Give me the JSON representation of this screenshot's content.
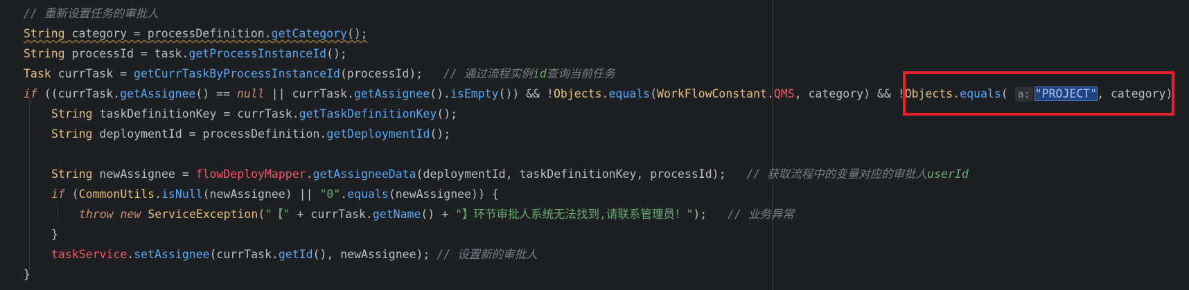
{
  "editor": {
    "lines": [
      {
        "id": "l1",
        "indent": 0,
        "tokens": [
          {
            "t": "// 重新设置任务的审批人",
            "c": "comment"
          }
        ]
      },
      {
        "id": "l2",
        "indent": 0,
        "tokens": [
          {
            "t": "String",
            "c": "ctype ul"
          },
          {
            "t": " category = ",
            "c": "plain ul"
          },
          {
            "t": "processDefinition",
            "c": "plain ul"
          },
          {
            "t": ".",
            "c": "plain ul"
          },
          {
            "t": "getCategory",
            "c": "method ul"
          },
          {
            "t": "();",
            "c": "plain ul"
          }
        ]
      },
      {
        "id": "l3",
        "indent": 0,
        "tokens": [
          {
            "t": "String",
            "c": "ctype"
          },
          {
            "t": " processId = task.",
            "c": "plain"
          },
          {
            "t": "getProcessInstanceId",
            "c": "method"
          },
          {
            "t": "();",
            "c": "plain"
          }
        ]
      },
      {
        "id": "l4",
        "indent": 0,
        "tokens": [
          {
            "t": "Task",
            "c": "ctype"
          },
          {
            "t": " currTask = ",
            "c": "plain"
          },
          {
            "t": "getCurrTaskByProcessInstanceId",
            "c": "method"
          },
          {
            "t": "(processId);   ",
            "c": "plain"
          },
          {
            "t": "// 通过流程实例",
            "c": "comment"
          },
          {
            "t": "id",
            "c": "comment-hl"
          },
          {
            "t": "查询当前任务",
            "c": "comment"
          }
        ]
      },
      {
        "id": "l5",
        "indent": 0,
        "tokens": [
          {
            "t": "if",
            "c": "kwi"
          },
          {
            "t": " ((currTask.",
            "c": "plain"
          },
          {
            "t": "getAssignee",
            "c": "method"
          },
          {
            "t": "() == ",
            "c": "plain"
          },
          {
            "t": "null",
            "c": "kwi"
          },
          {
            "t": " || currTask.",
            "c": "plain"
          },
          {
            "t": "getAssignee",
            "c": "method"
          },
          {
            "t": "().",
            "c": "plain"
          },
          {
            "t": "isEmpty",
            "c": "method"
          },
          {
            "t": "()) && !",
            "c": "plain"
          },
          {
            "t": "Objects",
            "c": "ctype"
          },
          {
            "t": ".",
            "c": "plain"
          },
          {
            "t": "equals",
            "c": "method"
          },
          {
            "t": "(",
            "c": "plain"
          },
          {
            "t": "WorkFlowConstant",
            "c": "ctype"
          },
          {
            "t": ".",
            "c": "plain"
          },
          {
            "t": "QMS",
            "c": "red-field"
          },
          {
            "t": ", category) && !",
            "c": "plain"
          },
          {
            "t": "Objects",
            "c": "ctype"
          },
          {
            "t": ".",
            "c": "plain"
          },
          {
            "t": "equals",
            "c": "method"
          },
          {
            "t": "( ",
            "c": "plain"
          },
          {
            "t": "a:",
            "c": "hint"
          },
          {
            "t": "\"PROJECT\"",
            "c": "str sel"
          },
          {
            "t": ", category)  ",
            "c": "plain"
          }
        ]
      },
      {
        "id": "l6",
        "indent": 1,
        "tokens": [
          {
            "t": "String",
            "c": "ctype"
          },
          {
            "t": " taskDefinitionKey = currTask.",
            "c": "plain"
          },
          {
            "t": "getTaskDefinitionKey",
            "c": "method"
          },
          {
            "t": "();",
            "c": "plain"
          }
        ]
      },
      {
        "id": "l7",
        "indent": 1,
        "tokens": [
          {
            "t": "String",
            "c": "ctype"
          },
          {
            "t": " deploymentId = processDefinition.",
            "c": "plain"
          },
          {
            "t": "getDeploymentId",
            "c": "method"
          },
          {
            "t": "();",
            "c": "plain"
          }
        ]
      },
      {
        "id": "l8",
        "indent": 1,
        "tokens": []
      },
      {
        "id": "l9",
        "indent": 1,
        "tokens": [
          {
            "t": "String",
            "c": "ctype"
          },
          {
            "t": " newAssignee = ",
            "c": "plain"
          },
          {
            "t": "flowDeployMapper",
            "c": "red-field"
          },
          {
            "t": ".",
            "c": "plain"
          },
          {
            "t": "getAssigneeData",
            "c": "method"
          },
          {
            "t": "(deploymentId, taskDefinitionKey, processId);   ",
            "c": "plain"
          },
          {
            "t": "// 获取流程中的变量对应的审批人",
            "c": "comment"
          },
          {
            "t": "userId",
            "c": "comment-hl"
          }
        ]
      },
      {
        "id": "l10",
        "indent": 1,
        "tokens": [
          {
            "t": "if",
            "c": "kwi"
          },
          {
            "t": " (",
            "c": "plain"
          },
          {
            "t": "CommonUtils",
            "c": "ctype"
          },
          {
            "t": ".",
            "c": "plain"
          },
          {
            "t": "isNull",
            "c": "method"
          },
          {
            "t": "(newAssignee) || ",
            "c": "plain"
          },
          {
            "t": "\"0\"",
            "c": "str"
          },
          {
            "t": ".",
            "c": "plain"
          },
          {
            "t": "equals",
            "c": "method"
          },
          {
            "t": "(newAssignee)) {",
            "c": "plain"
          }
        ]
      },
      {
        "id": "l11",
        "indent": 2,
        "tokens": [
          {
            "t": "throw",
            "c": "kwi"
          },
          {
            "t": " ",
            "c": "plain"
          },
          {
            "t": "new",
            "c": "kwi"
          },
          {
            "t": " ",
            "c": "plain"
          },
          {
            "t": "ServiceException",
            "c": "ctype"
          },
          {
            "t": "(",
            "c": "plain"
          },
          {
            "t": "\"【\"",
            "c": "str"
          },
          {
            "t": " + currTask.",
            "c": "plain"
          },
          {
            "t": "getName",
            "c": "method"
          },
          {
            "t": "() + ",
            "c": "plain"
          },
          {
            "t": "\"】环节审批人系统无法找到,请联系管理员！\"",
            "c": "str"
          },
          {
            "t": ");   ",
            "c": "plain"
          },
          {
            "t": "// 业务异常",
            "c": "comment"
          }
        ]
      },
      {
        "id": "l12",
        "indent": 1,
        "tokens": [
          {
            "t": "}",
            "c": "plain"
          }
        ]
      },
      {
        "id": "l13",
        "indent": 1,
        "tokens": [
          {
            "t": "taskService",
            "c": "red-field"
          },
          {
            "t": ".",
            "c": "plain"
          },
          {
            "t": "setAssignee",
            "c": "method"
          },
          {
            "t": "(currTask.",
            "c": "plain"
          },
          {
            "t": "getId",
            "c": "method"
          },
          {
            "t": "(), newAssignee); ",
            "c": "plain"
          },
          {
            "t": "// 设置新的审批人",
            "c": "comment"
          }
        ]
      },
      {
        "id": "l14",
        "indent": 0,
        "tokens": [
          {
            "t": "}",
            "c": "plain"
          }
        ]
      }
    ]
  }
}
